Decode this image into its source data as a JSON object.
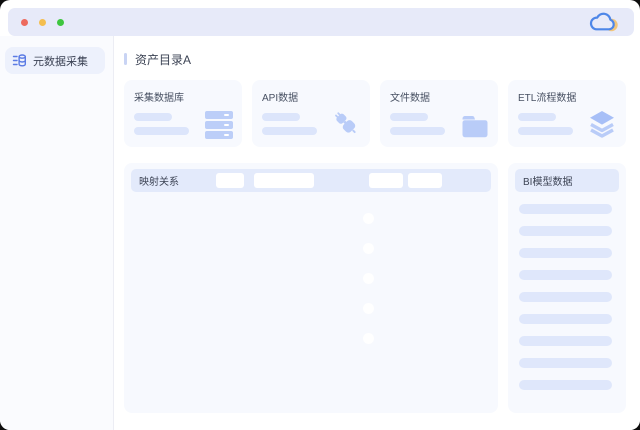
{
  "colors": {
    "topbar_bg": "#E7EAF9",
    "accent_blue": "#5B7BE4",
    "toggle_on": "#8FACEF",
    "placeholder_bar": "#DCE5FB",
    "panel_bg": "#F7F9FE",
    "panel_header_bg": "#E3EAFB",
    "traffic_red": "#ED6A5E",
    "traffic_yellow": "#F4BE4F",
    "traffic_green": "#3EC63F",
    "cloud_stroke": "#4D86E8",
    "cloud_moon": "#F1C57C"
  },
  "titlebar": {
    "traffic_lights": [
      "red",
      "yellow",
      "green"
    ],
    "logo_icon": "cloud-icon"
  },
  "sidebar": {
    "items": [
      {
        "icon": "metadata-collection-icon",
        "label": "元数据采集",
        "active": true
      }
    ]
  },
  "main": {
    "page_title": "资产目录A",
    "cards": [
      {
        "title": "采集数据库",
        "icon": "database-server-icon"
      },
      {
        "title": "API数据",
        "icon": "plug-icon"
      },
      {
        "title": "文件数据",
        "icon": "folder-icon"
      },
      {
        "title": "ETL流程数据",
        "icon": "layers-icon"
      }
    ],
    "mapping_panel": {
      "title": "映射关系",
      "header_buttons": [
        {
          "width": 28,
          "gap": 37
        },
        {
          "width": 60,
          "gap": 10
        },
        {
          "width": 34,
          "gap": 55
        },
        {
          "width": 34,
          "gap": 5
        }
      ],
      "rows": [
        {
          "bars": [
            72,
            105,
            78
          ],
          "toggle_on": true
        },
        {
          "bars": [
            38,
            60,
            28
          ],
          "toggle_on": true
        },
        {
          "bars": [
            58,
            90,
            78
          ],
          "toggle_on": true
        },
        {
          "bars": [
            72,
            40,
            46
          ],
          "toggle_on": true
        },
        {
          "bars": [
            72,
            100,
            46
          ],
          "toggle_on": true
        }
      ]
    },
    "bi_panel": {
      "title": "BI模型数据",
      "item_count": 9
    }
  }
}
